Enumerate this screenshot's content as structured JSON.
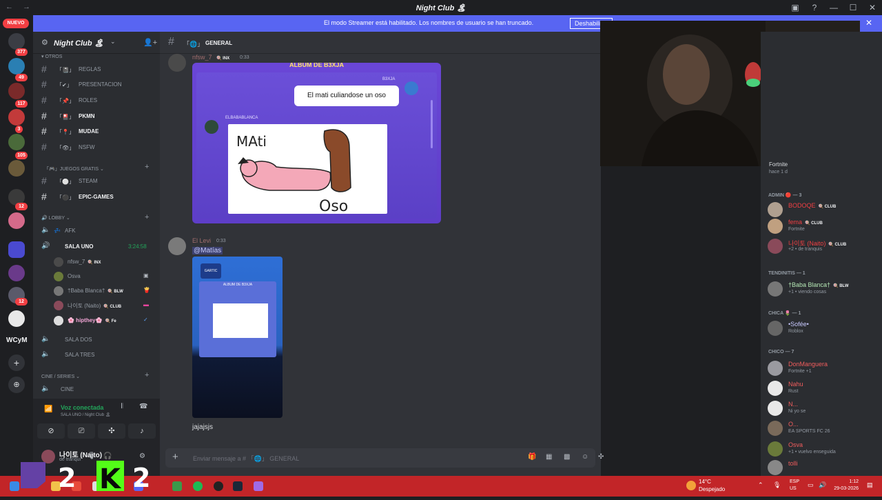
{
  "window": {
    "title": "Night Club 🏝",
    "back": "←",
    "forward": "→",
    "min": "—",
    "max": "☐",
    "close": "✕"
  },
  "banner": {
    "message": "El modo Streamer está habilitado. Los nombres de usuario se han truncado.",
    "button": "Deshabilitar",
    "close": "✕"
  },
  "servers": {
    "nuevo": "NUEVO",
    "badges": [
      "377",
      "49",
      "117",
      "3",
      "105",
      "12",
      "12"
    ],
    "wcym": "WCyM"
  },
  "sidebar": {
    "server_name": "Night Club 🏝",
    "categories": {
      "otros": "otros",
      "juegos": "juegos gratis",
      "lobby": "lobby",
      "cine": "cine / series"
    },
    "channels": [
      {
        "emoji": "「📓」",
        "label": "REGLAS",
        "bold": false
      },
      {
        "emoji": "「✔」",
        "label": "PRESENTACION",
        "bold": false
      },
      {
        "emoji": "「📌」",
        "label": "ROLES",
        "bold": false
      },
      {
        "emoji": "「🎴」",
        "label": "PKMN",
        "bold": true
      },
      {
        "emoji": "「📍」",
        "label": "MUDAE",
        "bold": true
      },
      {
        "emoji": "「👁」",
        "label": "NSFW",
        "bold": false
      }
    ],
    "game_channels": [
      {
        "emoji": "「⚪」",
        "label": "STEAM",
        "bold": false
      },
      {
        "emoji": "「⚫」",
        "label": "EPIC-GAMES",
        "bold": true
      }
    ],
    "voice": {
      "afk": "AFK",
      "afk_emoji": "💤",
      "sala_uno": "SALA UNO",
      "sala_uno_time": "3:24:58",
      "sala_dos": "SALA DOS",
      "sala_tres": "SALA TRES",
      "cine": "CINE"
    },
    "voice_users": [
      {
        "name": "nfsw_7",
        "tag": "🍭 INX",
        "icon": ""
      },
      {
        "name": "Osva",
        "tag": "",
        "icon": "▣"
      },
      {
        "name": "†Baba Blanca†",
        "tag": "🍭 BLW",
        "icon": "🍟"
      },
      {
        "name": "나이토 (Naito)",
        "tag": "🍭 CLUB",
        "icon": "▬"
      },
      {
        "name": "🌸 hipthey🌸",
        "tag": "🍭 Fe",
        "icon": "✓"
      }
    ]
  },
  "voice_panel": {
    "status": "Voz conectada",
    "sub": "SALA UNO / Night Club 🏝",
    "username": "나이토 (Naito)",
    "user_status": "de tranqui"
  },
  "chat": {
    "channel_emoji": "「🌐」",
    "channel_name": "GENERAL",
    "messages": [
      {
        "author": "nfsw_7",
        "tag": "🍭 INX",
        "time": "0:33"
      },
      {
        "author": "El Levi",
        "time": "0:33",
        "mention": "@Matías",
        "text": "jajajsjs"
      }
    ],
    "album": {
      "title": "ALBUM DE B3XJA",
      "bubble": "El mati culiandose un oso",
      "b3xja": "B3XJA",
      "elbaba": "ELBABABLANCA",
      "drawing_text_1": "MAti",
      "drawing_text_2": "Oso"
    },
    "phone": {
      "album_label": "ALBUM DE B3XJA",
      "phone_logo": "GARTIC PHONE"
    },
    "composer_placeholder": "Enviar mensaje a # 「🌐」 GENERAL"
  },
  "members": {
    "top_name": "Fortnite",
    "top_status": "hace 1 d",
    "groups": [
      {
        "label": "admin 🔴 — 3",
        "members": [
          {
            "name": "BODOQE",
            "tag": "🍭 CLUB",
            "status": "",
            "color": "#f23f43"
          },
          {
            "name": "fema",
            "tag": "🍭 CLUB",
            "status": "Fortnite",
            "color": "#f23f43"
          },
          {
            "name": "나이토 (Naito)",
            "tag": "🍭 CLUB",
            "status": "+2 • de tranquis",
            "color": "#f23f43"
          }
        ]
      },
      {
        "label": "tendinitis — 1",
        "members": [
          {
            "name": "†Baba Blanca†",
            "tag": "🍭 BLW",
            "status": "+1 • viendo cosas",
            "color": "#b5e8b5"
          }
        ]
      },
      {
        "label": "chica 🌷 — 1",
        "members": [
          {
            "name": "•Sofée•",
            "tag": "",
            "status": "Roblox",
            "color": "#c9c9ff"
          }
        ]
      },
      {
        "label": "chico — 7",
        "members": [
          {
            "name": "DonManguera",
            "tag": "",
            "status": "Fortnite +1",
            "color": "#f25d5d"
          },
          {
            "name": "Nahu",
            "tag": "",
            "status": "Rust",
            "color": "#f25d5d"
          },
          {
            "name": "N...",
            "tag": "",
            "status": "Ni yo se",
            "color": "#f25d5d"
          },
          {
            "name": "O...",
            "tag": "",
            "status": "EA SPORTS FC 26",
            "color": "#f25d5d"
          },
          {
            "name": "Osva",
            "tag": "",
            "status": "+1 • vuelvo enseguida",
            "color": "#f25d5d"
          },
          {
            "name": "tolli",
            "tag": "",
            "status": "",
            "color": "#f25d5d"
          }
        ]
      }
    ]
  },
  "taskbar": {
    "temp": "14°C",
    "weather": "Despejado",
    "lang1": "ESP",
    "lang2": "US",
    "time": "1:12",
    "date": "29-03-2026"
  },
  "overlay": {
    "text": "2",
    "text2": "2",
    "k": "K"
  },
  "colors": {
    "accent": "#5865f2",
    "online": "#23a55a",
    "danger": "#f23f43",
    "taskbar": "#c22528"
  }
}
